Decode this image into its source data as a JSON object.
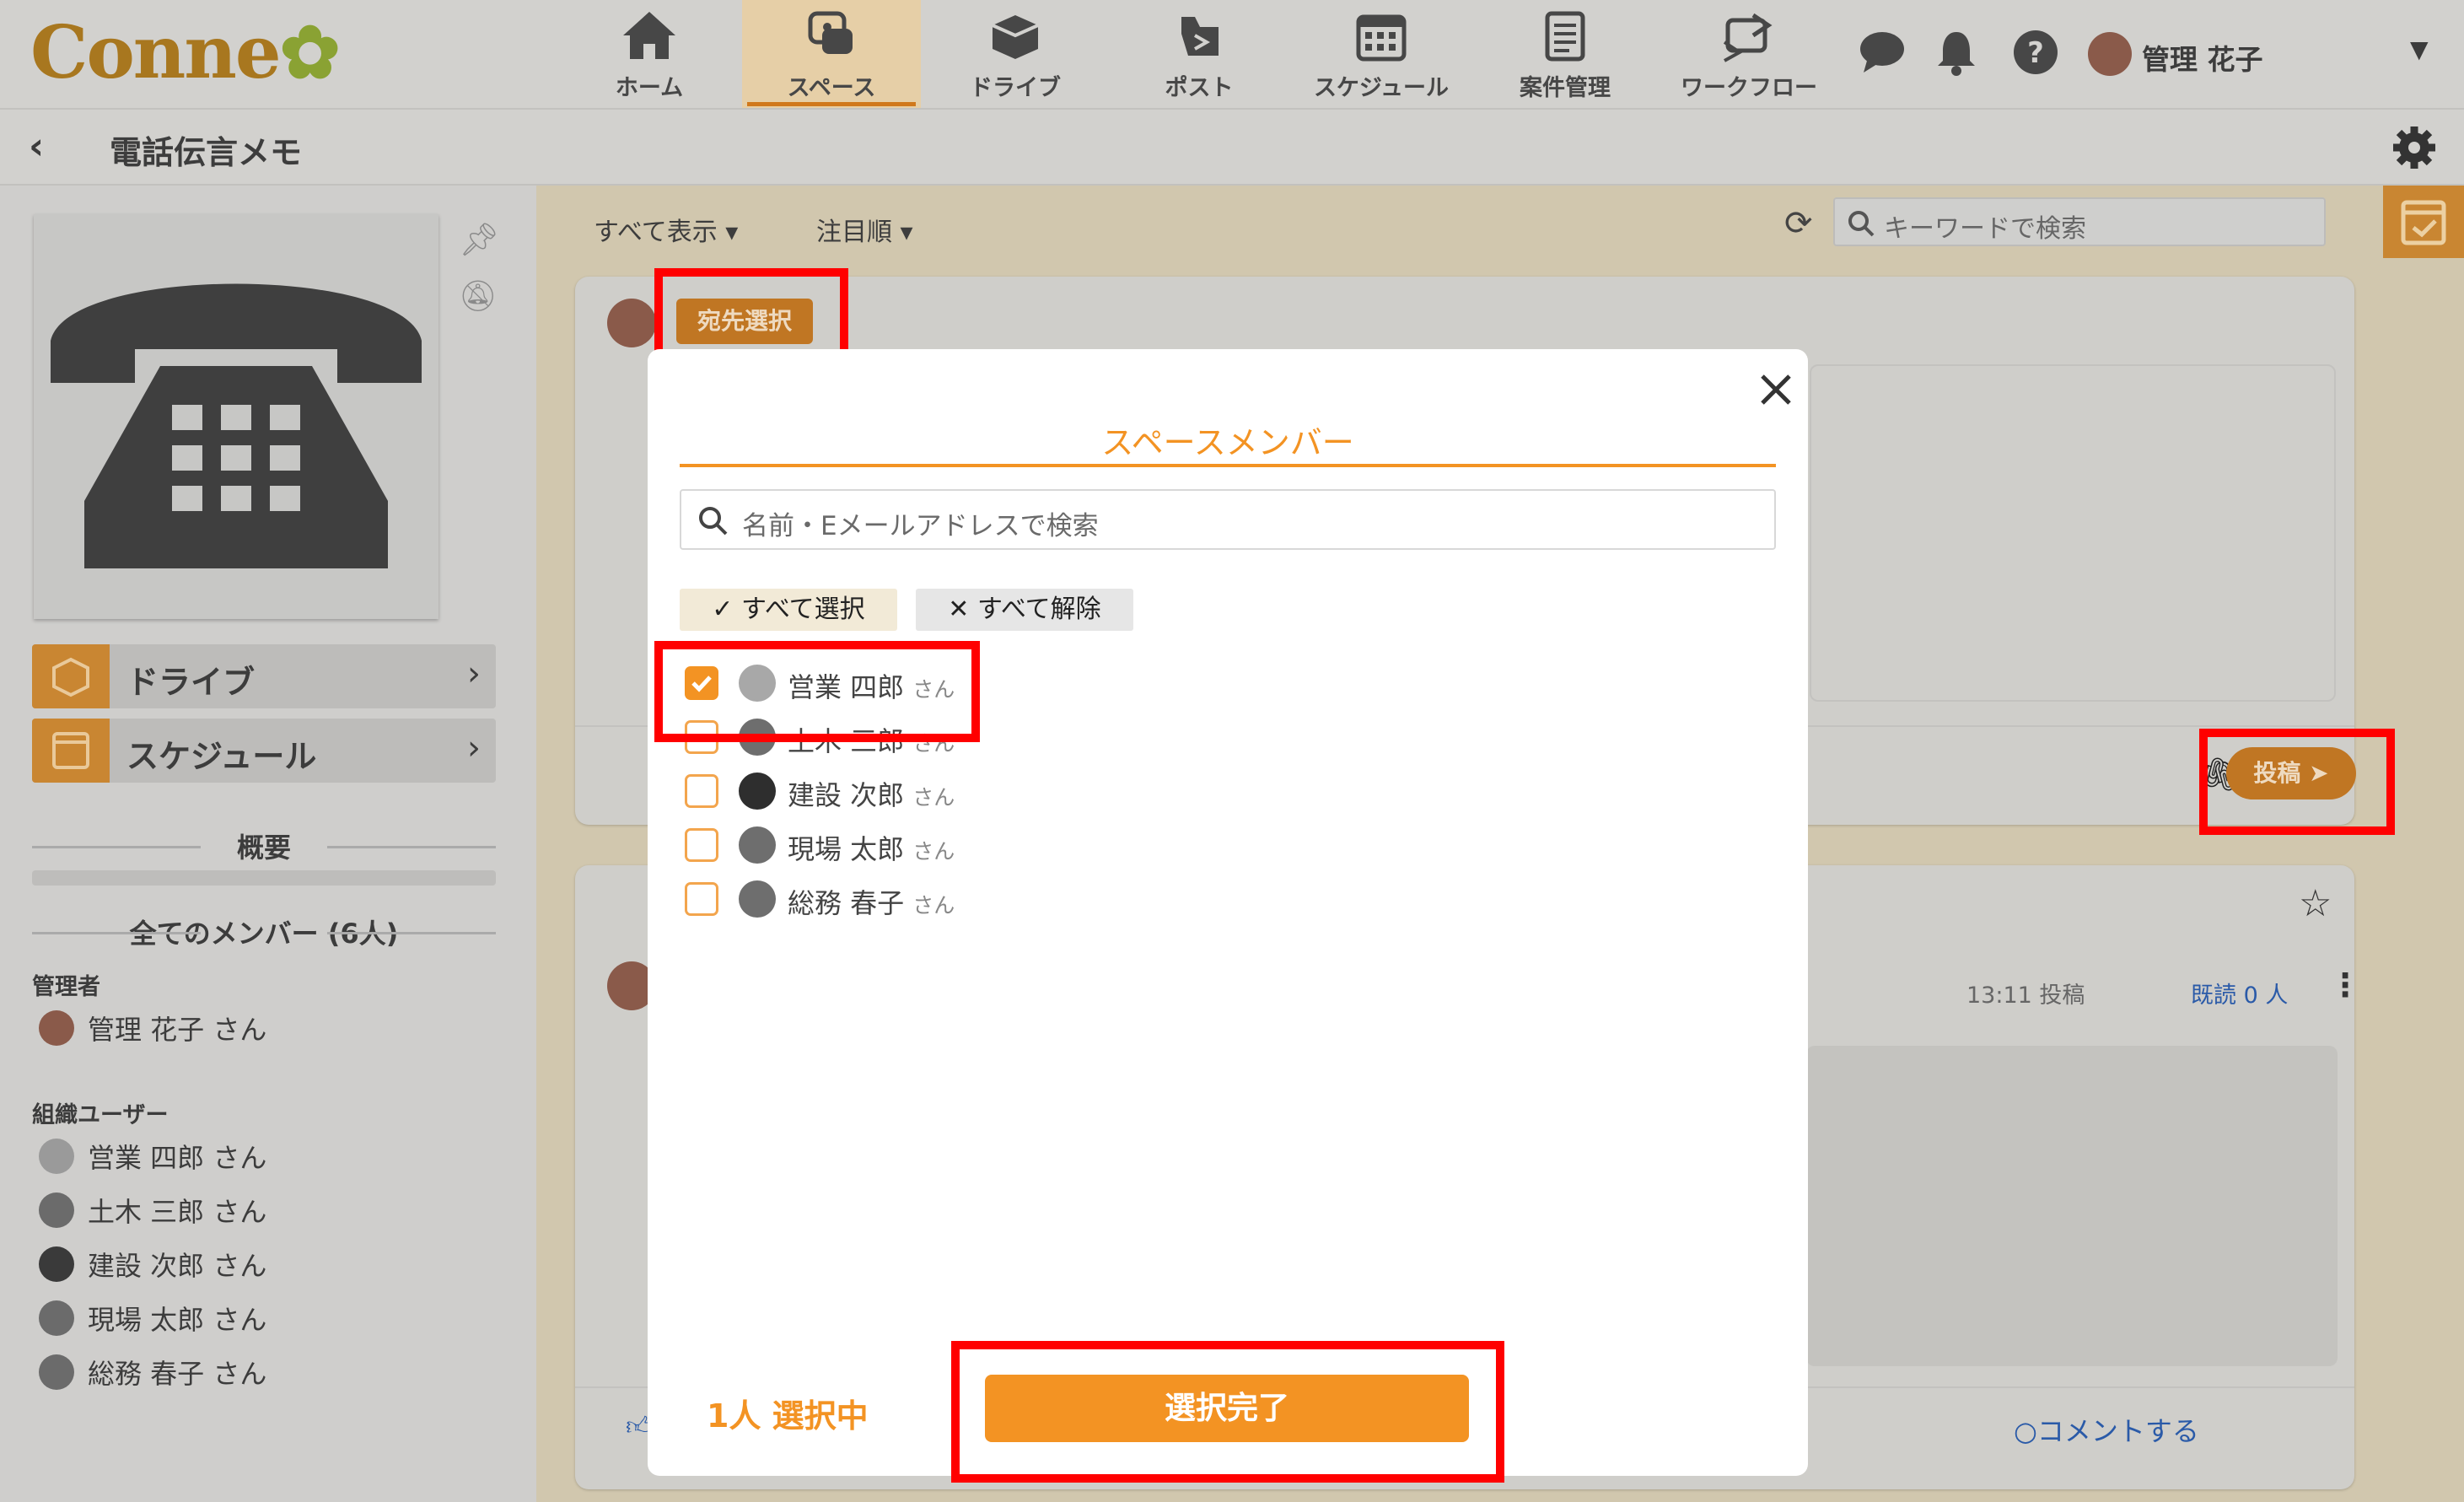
{
  "app": {
    "logo": "Conne"
  },
  "nav": {
    "items": [
      {
        "label": "ホーム",
        "icon": "home-icon"
      },
      {
        "label": "スペース",
        "icon": "space-icon",
        "active": true
      },
      {
        "label": "ドライブ",
        "icon": "drive-icon"
      },
      {
        "label": "ポスト",
        "icon": "post-icon"
      },
      {
        "label": "スケジュール",
        "icon": "schedule-icon"
      },
      {
        "label": "案件管理",
        "icon": "case-icon"
      },
      {
        "label": "ワークフロー",
        "icon": "workflow-icon"
      }
    ],
    "user_name": "管理 花子"
  },
  "page": {
    "title": "電話伝言メモ"
  },
  "sidebar": {
    "links": [
      {
        "label": "ドライブ"
      },
      {
        "label": "スケジュール"
      }
    ],
    "overview_label": "概要",
    "members_header": "全てのメンバー (6人)",
    "admin_label": "管理者",
    "admin": "管理 花子 さん",
    "org_label": "組織ユーザー",
    "org_users": [
      "営業 四郎 さん",
      "土木 三郎 さん",
      "建設 次郎 さん",
      "現場 太郎 さん",
      "総務 春子 さん"
    ]
  },
  "main": {
    "filter_label": "すべて表示",
    "sort_label": "注目順",
    "search_placeholder": "キーワードで検索",
    "recipient_button": "宛先選択",
    "post_button": "投稿",
    "post_time": "13:11",
    "post_label": "投稿",
    "read_label": "既読 0 人",
    "comment_label": "コメントする"
  },
  "modal": {
    "title": "スペースメンバー",
    "search_placeholder": "名前・Eメールアドレスで検索",
    "select_all": "すべて選択",
    "deselect_all": "すべて解除",
    "members": [
      {
        "name": "営業 四郎",
        "suffix": "さん",
        "checked": true
      },
      {
        "name": "土木 三郎",
        "suffix": "さん",
        "checked": false
      },
      {
        "name": "建設 次郎",
        "suffix": "さん",
        "checked": false
      },
      {
        "name": "現場 太郎",
        "suffix": "さん",
        "checked": false
      },
      {
        "name": "総務 春子",
        "suffix": "さん",
        "checked": false
      }
    ],
    "selected_count": "1人 選択中",
    "done_button": "選択完了"
  },
  "colors": {
    "accent": "#f39323",
    "highlight": "#ff0000",
    "overlay_main": "#d1c7ae"
  }
}
